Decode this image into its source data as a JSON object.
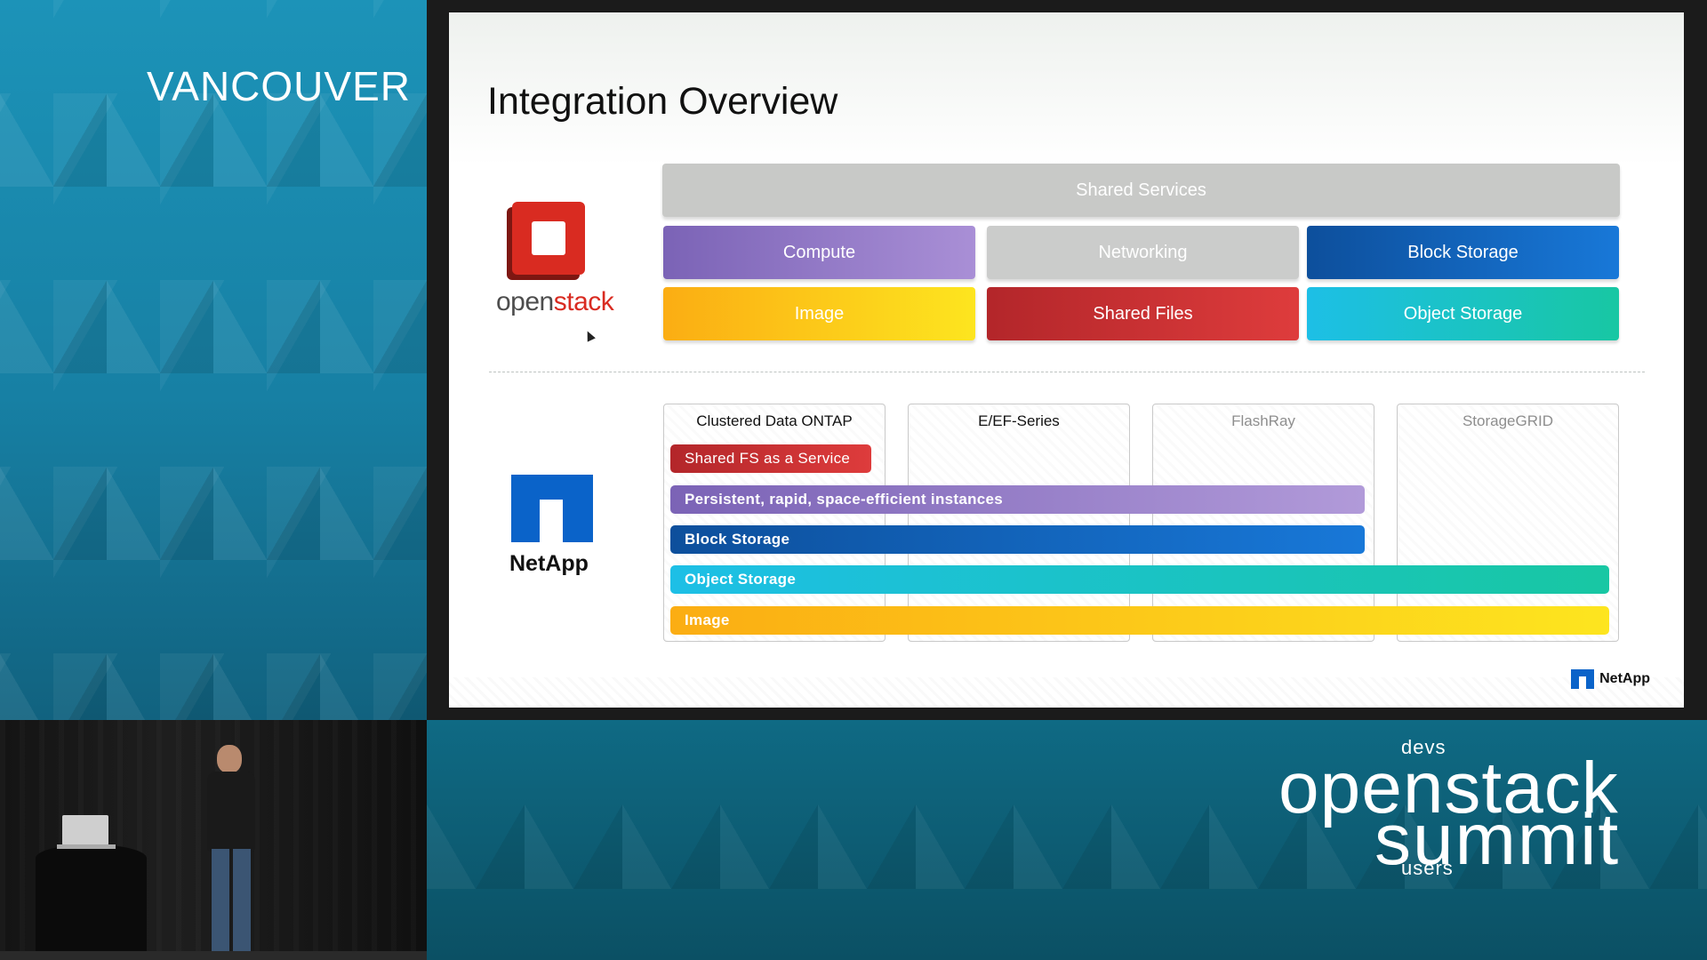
{
  "event": {
    "city": "VANCOUVER",
    "logo_top": "devs",
    "logo_main": "openstack",
    "logo_sub": "summit",
    "logo_bottom": "users"
  },
  "slide": {
    "title": "Integration Overview",
    "openstack_logo_word_a": "open",
    "openstack_logo_word_b": "stack",
    "openstack_services": {
      "shared": "Shared Services",
      "compute": "Compute",
      "networking": "Networking",
      "block_storage": "Block Storage",
      "image": "Image",
      "shared_files": "Shared Files",
      "object_storage": "Object Storage"
    },
    "netapp_logo_word": "NetApp",
    "netapp_columns": [
      "Clustered Data ONTAP",
      "E/EF-Series",
      "FlashRay",
      "StorageGRID"
    ],
    "netapp_bars": {
      "shared_fs": "Shared FS as a Service",
      "persistent": "Persistent, rapid, space-efficient instances",
      "block_storage": "Block Storage",
      "object_storage": "Object Storage",
      "image": "Image"
    },
    "footer_logo_word": "NetApp"
  },
  "colors": {
    "compute": "#7b63b6",
    "block_storage": "#0d4f9c",
    "image": "#fbad13",
    "shared_files": "#b3262a",
    "object_storage": "#1dbfe6",
    "shared_services": "#c8c9c7",
    "openstack_red": "#d92b21",
    "netapp_blue": "#0a63c9"
  }
}
